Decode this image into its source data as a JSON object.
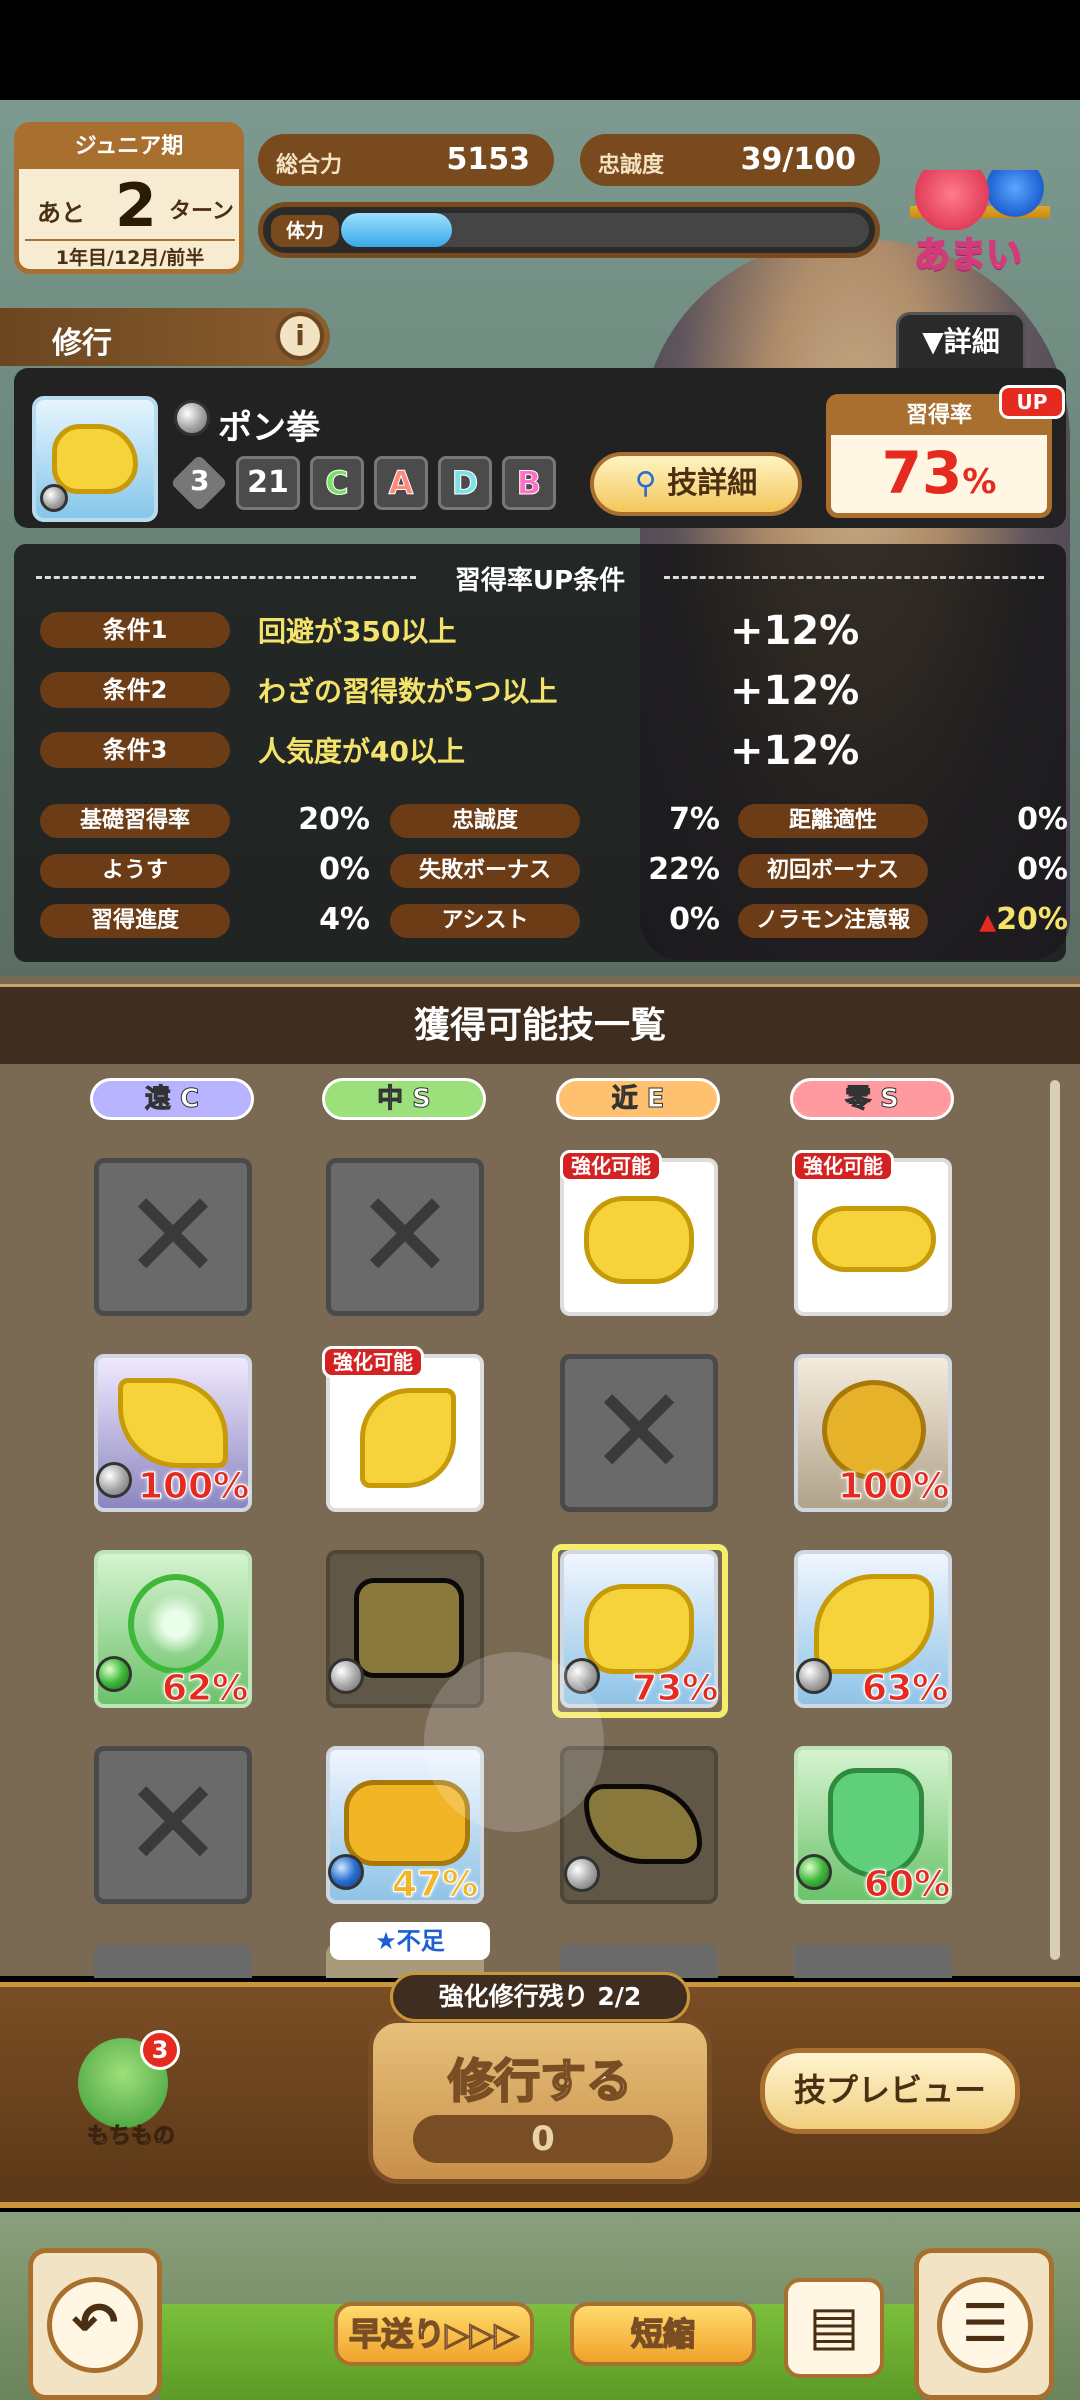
{
  "header": {
    "period": "ジュニア期",
    "turns_prefix": "あと",
    "turns_value": "2",
    "turns_suffix": "ターン",
    "date": "1年目/12月/前半",
    "power_label": "総合力",
    "power_value": "5153",
    "loyalty_label": "忠誠度",
    "loyalty_value": "39/100",
    "stamina_label": "体力",
    "stamina_fraction": 0.21,
    "mood_label": "あまい"
  },
  "training": {
    "label": "修行",
    "info_icon": "i",
    "detail_tab": "▼詳細"
  },
  "skill": {
    "name": "ポン拳",
    "level": "3",
    "cost": "21",
    "grades": [
      "C",
      "A",
      "D",
      "B"
    ],
    "grade_colors": [
      "#7be06a",
      "#ff8a7a",
      "#7de0e6",
      "#ff6ec7"
    ],
    "detail_button": "技詳細",
    "rate_label": "習得率",
    "rate_value": "73",
    "rate_unit": "%",
    "up_badge": "UP"
  },
  "conditions": {
    "title": "習得率UP条件",
    "items": [
      {
        "tag": "条件1",
        "text": "回避が350以上",
        "bonus": "+12%"
      },
      {
        "tag": "条件2",
        "text": "わざの習得数が5つ以上",
        "bonus": "+12%"
      },
      {
        "tag": "条件3",
        "text": "人気度が40以上",
        "bonus": "+12%"
      }
    ],
    "stats": [
      {
        "k": "基礎習得率",
        "v": "20%"
      },
      {
        "k": "忠誠度",
        "v": "7%"
      },
      {
        "k": "距離適性",
        "v": "0%"
      },
      {
        "k": "ようす",
        "v": "0%"
      },
      {
        "k": "失敗ボーナス",
        "v": "22%"
      },
      {
        "k": "初回ボーナス",
        "v": "0%"
      },
      {
        "k": "習得進度",
        "v": "4%"
      },
      {
        "k": "アシスト",
        "v": "0%"
      },
      {
        "k": "ノラモン注意報",
        "v": "20%"
      }
    ]
  },
  "list": {
    "title": "獲得可能技一覧",
    "columns": [
      {
        "kind": "遠",
        "grade": "C",
        "color": "#b7b3ff"
      },
      {
        "kind": "中",
        "grade": "S",
        "color": "#9be07a"
      },
      {
        "kind": "近",
        "grade": "E",
        "color": "#ffc070"
      },
      {
        "kind": "零",
        "grade": "S",
        "color": "#ff9aa0"
      }
    ],
    "enhance_label": "強化可能",
    "shortfall": "★不足",
    "percents": [
      "100%",
      "100%",
      "62%",
      "73%",
      "63%",
      "47%",
      "60%"
    ]
  },
  "actions": {
    "items_label": "もちもの",
    "items_count": "3",
    "remaining": "強化修行残り 2/2",
    "train_button": "修行する",
    "train_cost": "0",
    "preview_button": "技プレビュー"
  },
  "footer": {
    "fast_forward": "早送り▷▷▷",
    "shorten": "短縮"
  }
}
